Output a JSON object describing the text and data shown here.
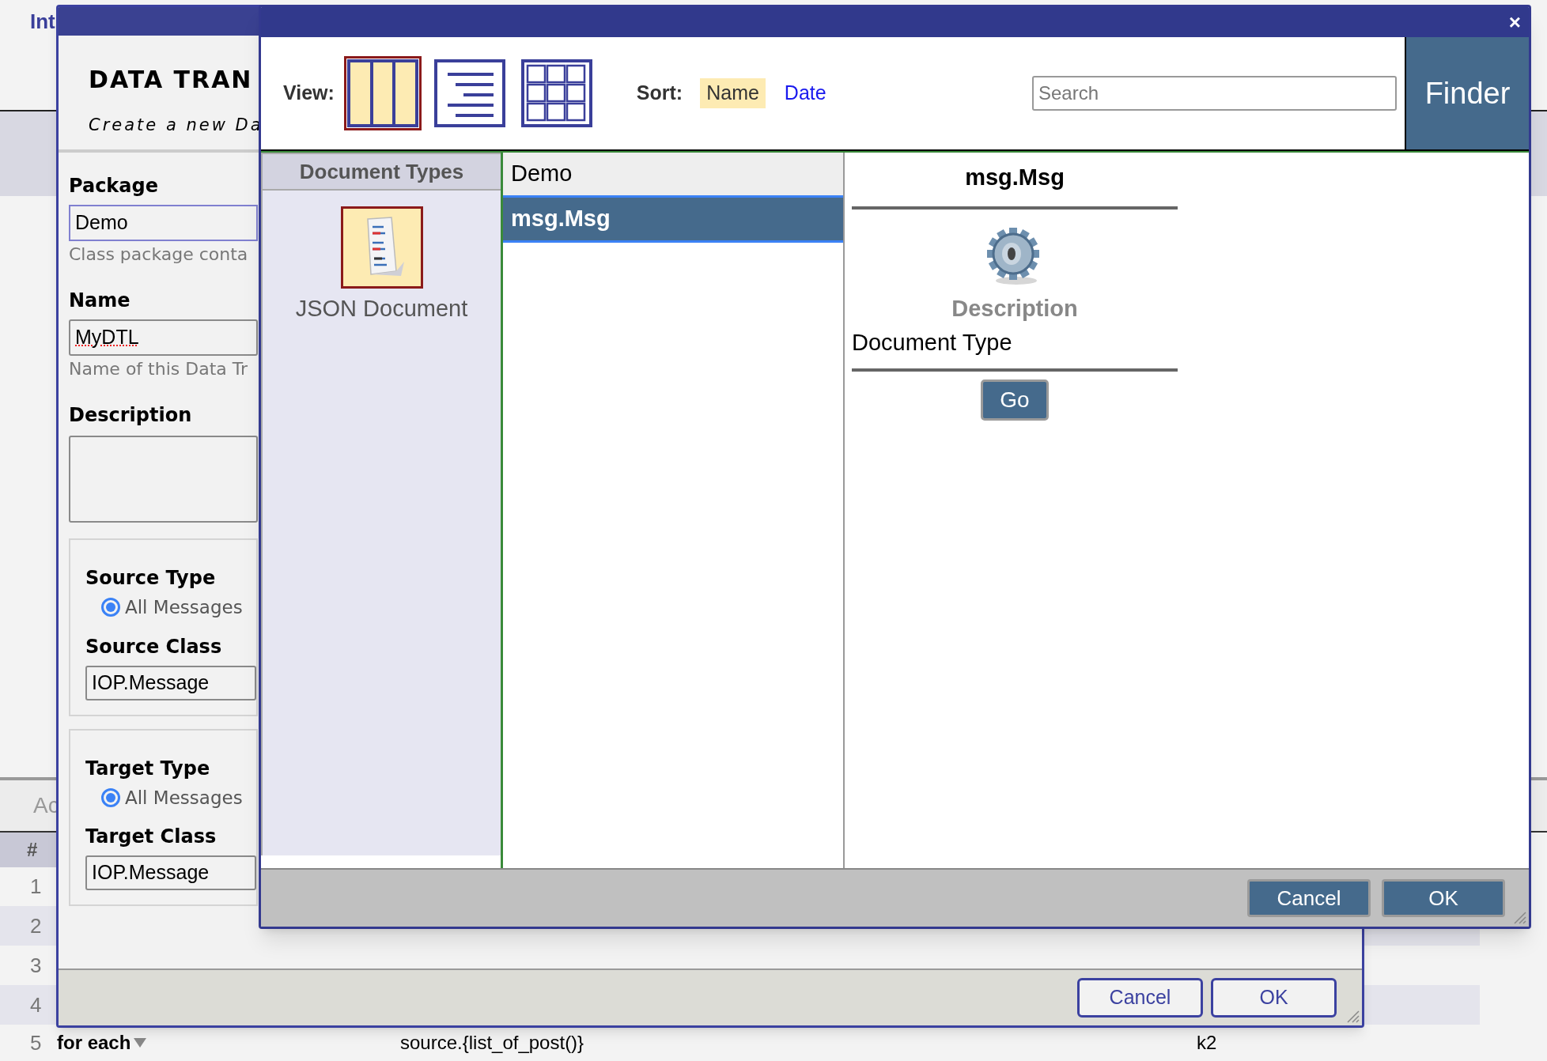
{
  "background_page": {
    "title": "Int",
    "tab": "Ac",
    "table": {
      "header": "#",
      "rows": [
        {
          "number": "1",
          "cells": []
        },
        {
          "number": "2",
          "cells": []
        },
        {
          "number": "3",
          "cells": []
        },
        {
          "number": "4",
          "cells": []
        },
        {
          "number": "5",
          "cells": [
            {
              "text": "for each",
              "dropdown": true
            },
            {
              "text": "source.{list_of_post()}",
              "dropdown": false
            },
            {
              "text": "k2",
              "dropdown": false
            }
          ]
        }
      ]
    }
  },
  "transformation_dialog": {
    "heading": "DATA TRAN",
    "subheading": "Create a new Da",
    "fields": [
      {
        "kind": "input",
        "label": "Package",
        "value": "Demo",
        "hint": "Class package conta",
        "focused": true
      },
      {
        "kind": "input",
        "label": "Name",
        "value": "MyDTL",
        "hint": "Name of this Data Tr",
        "focused": false
      },
      {
        "kind": "textarea",
        "label": "Description",
        "focused": false
      }
    ],
    "groups": [
      {
        "type_label": "Source Type",
        "option": {
          "label": "All Messages",
          "selected": true
        },
        "class_label": "Source Class",
        "class_value": "IOP.Message"
      },
      {
        "type_label": "Target Type",
        "option": {
          "label": "All Messages",
          "selected": true
        },
        "class_label": "Target Class",
        "class_value": "IOP.Message"
      }
    ],
    "buttons": [
      "Cancel",
      "OK"
    ]
  },
  "finder_dialog": {
    "close": "×",
    "view_label": "View:",
    "views": [
      {
        "kind": "columns",
        "selected": true
      },
      {
        "kind": "list",
        "selected": false
      },
      {
        "kind": "grid",
        "selected": false
      }
    ],
    "sort_label": "Sort:",
    "sort_options": [
      {
        "label": "Name",
        "selected": true
      },
      {
        "label": "Date",
        "selected": false
      }
    ],
    "search": {
      "placeholder": "Search"
    },
    "brand": "Finder",
    "category_header": "Document Types",
    "categories": [
      {
        "label": "JSON Document",
        "selected": true
      }
    ],
    "items": [
      {
        "label": "Demo",
        "selected": false
      },
      {
        "label": "msg.Msg",
        "selected": true
      }
    ],
    "details": {
      "title": "msg.Msg",
      "description_label": "Description",
      "description": "Document Type",
      "button": "Go"
    },
    "buttons": [
      "Cancel",
      "OK"
    ]
  }
}
